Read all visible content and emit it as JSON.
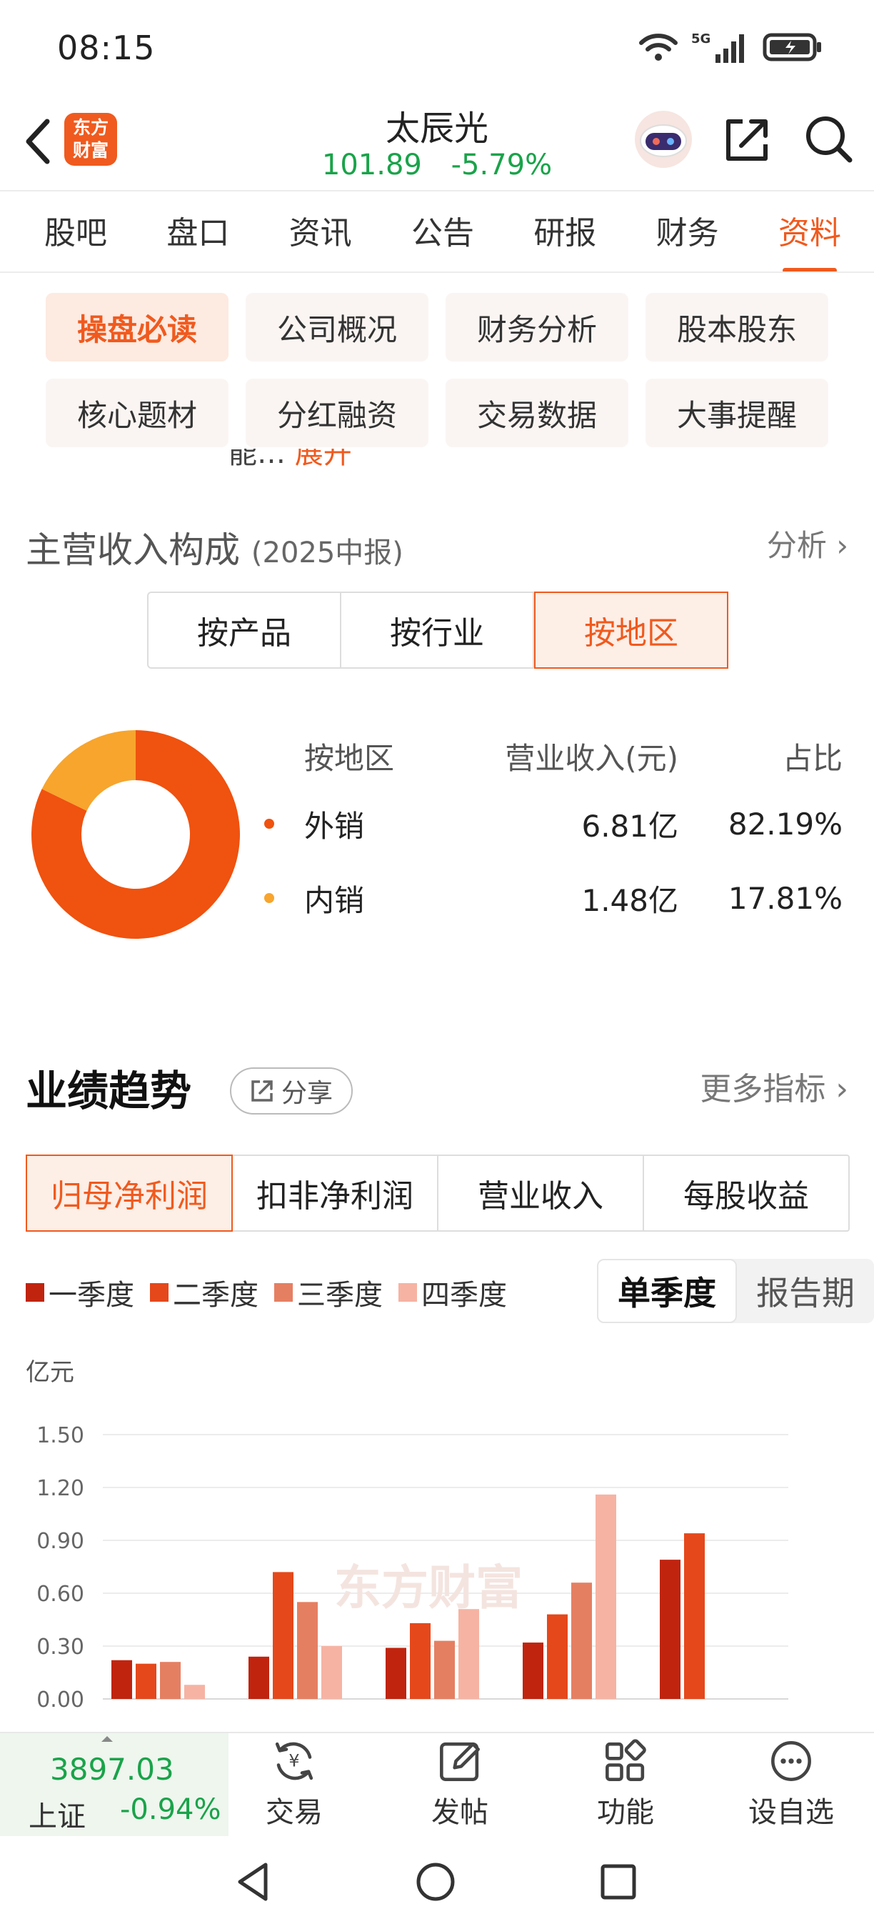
{
  "status": {
    "time": "08:15",
    "network": "5G"
  },
  "header": {
    "logo_line1": "东方",
    "logo_line2": "财富",
    "title": "太辰光",
    "price": "101.89",
    "change": "-5.79%"
  },
  "tabs": [
    "股吧",
    "盘口",
    "资讯",
    "公告",
    "研报",
    "财务",
    "资料"
  ],
  "active_tab": "资料",
  "chips": [
    "操盘必读",
    "公司概况",
    "财务分析",
    "股本股东",
    "核心题材",
    "分红融资",
    "交易数据",
    "大事提醒"
  ],
  "fragment": {
    "text": "能… ",
    "link": "展开"
  },
  "revenue": {
    "title": "主营收入构成",
    "subtitle": "(2025中报)",
    "link": "分析 ›",
    "segments": [
      "按产品",
      "按行业",
      "按地区"
    ],
    "active_segment": "按地区",
    "header": {
      "c1": "按地区",
      "c2": "营业收入(元)",
      "c3": "占比"
    },
    "rows": [
      {
        "name": "外销",
        "revenue": "6.81亿",
        "share": "82.19%",
        "color": "#f0520f"
      },
      {
        "name": "内销",
        "revenue": "1.48亿",
        "share": "17.81%",
        "color": "#f7a52d"
      }
    ]
  },
  "performance": {
    "title": "业绩趋势",
    "share": "分享",
    "more": "更多指标 ›",
    "tabs": [
      "归母净利润",
      "扣非净利润",
      "营业收入",
      "每股收益"
    ],
    "active_tab": "归母净利润",
    "toggle": [
      "单季度",
      "报告期"
    ],
    "active_toggle": "单季度",
    "watermark": "东方财富"
  },
  "chart_data": {
    "type": "bar",
    "ylabel": "亿元",
    "yticks": [
      "0.00",
      "0.30",
      "0.60",
      "0.90",
      "1.20",
      "1.50"
    ],
    "ylim": [
      0,
      1.5
    ],
    "groups": 5,
    "series": [
      {
        "name": "一季度",
        "color": "#c0240f",
        "values": [
          0.22,
          0.24,
          0.29,
          0.32,
          0.79
        ]
      },
      {
        "name": "二季度",
        "color": "#e5481b",
        "values": [
          0.2,
          0.72,
          0.43,
          0.48,
          0.94
        ]
      },
      {
        "name": "三季度",
        "color": "#e57f62",
        "values": [
          0.21,
          0.55,
          0.33,
          0.66,
          null
        ]
      },
      {
        "name": "四季度",
        "color": "#f6b3a3",
        "values": [
          0.08,
          0.3,
          0.51,
          1.16,
          null
        ]
      }
    ]
  },
  "bottom": {
    "index_value": "3897.03",
    "index_name": "上证",
    "index_change": "-0.94%",
    "nav": [
      "交易",
      "发帖",
      "功能",
      "设自选"
    ]
  }
}
